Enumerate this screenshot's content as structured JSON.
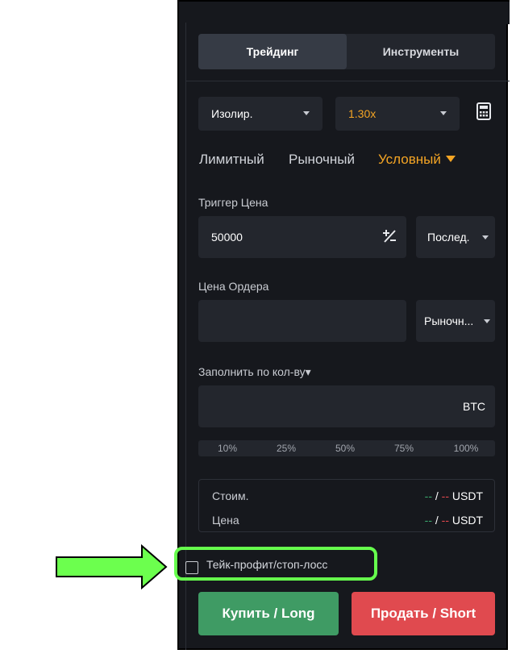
{
  "tabs": [
    {
      "label": "Трейдинг",
      "active": true
    },
    {
      "label": "Инструменты",
      "active": false
    }
  ],
  "margin_mode": {
    "value": "Изолир."
  },
  "leverage": {
    "value": "1.30x",
    "color": "#f5a524"
  },
  "calculator_icon": "calculator-icon",
  "order_types": [
    {
      "label": "Лимитный",
      "active": false
    },
    {
      "label": "Рыночный",
      "active": false
    },
    {
      "label": "Условный",
      "active": true
    }
  ],
  "trigger": {
    "label": "Триггер Цена",
    "value": "50000",
    "pm_symbol": "⁺∕₋",
    "price_type": "Послед."
  },
  "order_price": {
    "label": "Цена Ордера",
    "value": "",
    "type": "Рыночн..."
  },
  "quantity": {
    "label": "Заполнить по кол-ву▾",
    "value": "",
    "unit": "BTC"
  },
  "percentages": [
    "10%",
    "25%",
    "50%",
    "75%",
    "100%"
  ],
  "summary": {
    "rows": [
      {
        "label": "Стоим.",
        "left_dash": "--",
        "sep": " / ",
        "right_dash": "--",
        "unit": " USDT"
      },
      {
        "label": "Цена",
        "left_dash": "--",
        "sep": " / ",
        "right_dash": "--",
        "unit": " USDT"
      }
    ]
  },
  "tp_sl": {
    "label": "Тейк-профит/стоп-лосс",
    "checked": false
  },
  "buttons": {
    "buy": "Купить / Long",
    "sell": "Продать / Short"
  },
  "colors": {
    "accent": "#f5a524",
    "buy": "#3f9b64",
    "sell": "#e04a4f",
    "highlight": "#66ff4d",
    "panel_bg": "#16181d"
  }
}
